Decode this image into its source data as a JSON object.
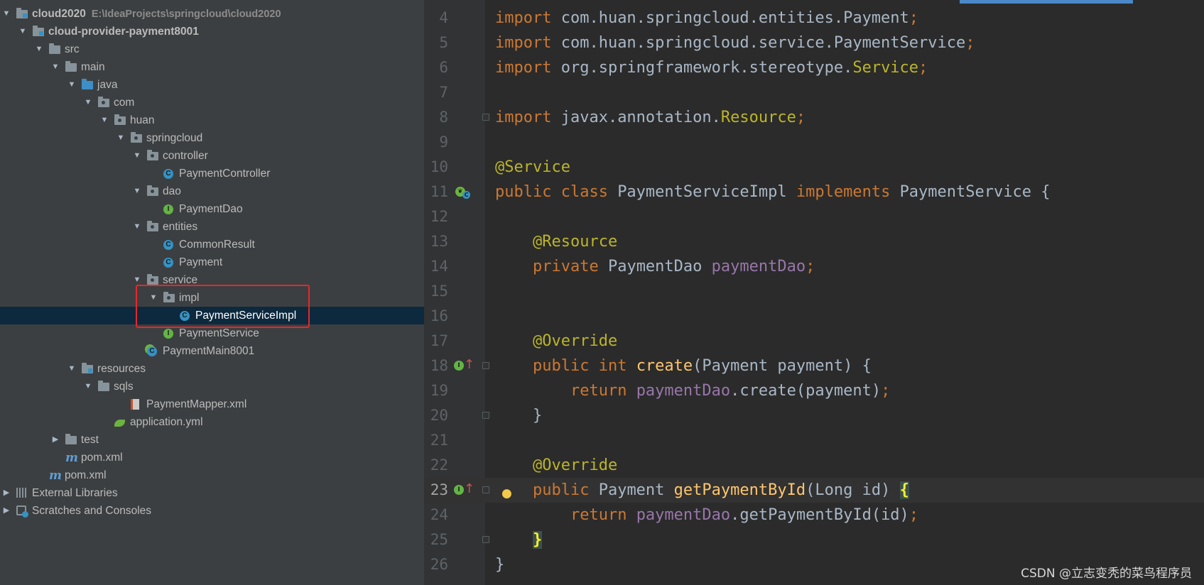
{
  "project_tree": {
    "rows": [
      {
        "label": "cloud2020",
        "path": "E:\\IdeaProjects\\springcloud\\cloud2020",
        "bold": true,
        "arrow": "down",
        "icon": "module-folder-icon",
        "level": 0
      },
      {
        "label": "cloud-provider-payment8001",
        "bold": true,
        "arrow": "down",
        "icon": "module-folder-icon",
        "level": 1
      },
      {
        "label": "src",
        "arrow": "down",
        "icon": "folder-icon",
        "level": 2
      },
      {
        "label": "main",
        "arrow": "down",
        "icon": "folder-icon",
        "level": 3
      },
      {
        "label": "java",
        "arrow": "down",
        "icon": "source-folder-icon",
        "level": 4
      },
      {
        "label": "com",
        "arrow": "down",
        "icon": "package-icon",
        "level": 5
      },
      {
        "label": "huan",
        "arrow": "down",
        "icon": "package-icon",
        "level": 6
      },
      {
        "label": "springcloud",
        "arrow": "down",
        "icon": "package-icon",
        "level": 7
      },
      {
        "label": "controller",
        "arrow": "down",
        "icon": "package-icon",
        "level": 8
      },
      {
        "label": "PaymentController",
        "icon": "class-icon",
        "level": 9
      },
      {
        "label": "dao",
        "arrow": "down",
        "icon": "package-icon",
        "level": 8
      },
      {
        "label": "PaymentDao",
        "icon": "interface-icon",
        "level": 9
      },
      {
        "label": "entities",
        "arrow": "down",
        "icon": "package-icon",
        "level": 8
      },
      {
        "label": "CommonResult",
        "icon": "class-icon",
        "level": 9
      },
      {
        "label": "Payment",
        "icon": "class-icon",
        "level": 9
      },
      {
        "label": "service",
        "arrow": "down",
        "icon": "package-icon",
        "level": 8
      },
      {
        "label": "impl",
        "arrow": "down",
        "icon": "package-icon",
        "level": 9
      },
      {
        "label": "PaymentServiceImpl",
        "icon": "class-icon",
        "level": 10,
        "selected": true
      },
      {
        "label": "PaymentService",
        "icon": "interface-icon",
        "level": 9
      },
      {
        "label": "PaymentMain8001",
        "icon": "spring-boot-class-icon",
        "level": 8
      },
      {
        "label": "resources",
        "arrow": "down",
        "icon": "resources-folder-icon",
        "level": 4
      },
      {
        "label": "sqls",
        "arrow": "down",
        "icon": "folder-icon",
        "level": 5
      },
      {
        "label": "PaymentMapper.xml",
        "icon": "xml-file-icon",
        "level": 7
      },
      {
        "label": "application.yml",
        "icon": "spring-yml-icon",
        "level": 6
      },
      {
        "label": "test",
        "arrow": "right",
        "icon": "folder-icon",
        "level": 3
      },
      {
        "label": "pom.xml",
        "icon": "maven-icon",
        "level": 3
      },
      {
        "label": "pom.xml",
        "icon": "maven-icon",
        "level": 2
      },
      {
        "label": "External Libraries",
        "arrow": "right",
        "icon": "libraries-icon",
        "level": 0
      },
      {
        "label": "Scratches and Consoles",
        "arrow": "right",
        "icon": "scratches-icon",
        "level": 0
      }
    ]
  },
  "editor": {
    "lines": [
      {
        "num": "4",
        "tokens": [
          [
            "kw",
            "import "
          ],
          [
            "",
            "com.huan.springcloud.entities.Payment"
          ],
          [
            "kw",
            ";"
          ]
        ]
      },
      {
        "num": "5",
        "tokens": [
          [
            "kw",
            "import "
          ],
          [
            "",
            "com.huan.springcloud.service.PaymentService"
          ],
          [
            "kw",
            ";"
          ]
        ]
      },
      {
        "num": "6",
        "tokens": [
          [
            "kw",
            "import "
          ],
          [
            "",
            "org.springframework.stereotype."
          ],
          [
            "ann",
            "Service"
          ],
          [
            "kw",
            ";"
          ]
        ]
      },
      {
        "num": "7",
        "tokens": []
      },
      {
        "num": "8",
        "tokens": [
          [
            "kw",
            "import "
          ],
          [
            "",
            "javax.annotation."
          ],
          [
            "ann",
            "Resource"
          ],
          [
            "kw",
            ";"
          ]
        ],
        "fold": true
      },
      {
        "num": "9",
        "tokens": []
      },
      {
        "num": "10",
        "tokens": [
          [
            "ann",
            "@Service"
          ]
        ]
      },
      {
        "num": "11",
        "tokens": [
          [
            "kw",
            "public class "
          ],
          [
            "",
            "PaymentServiceImpl "
          ],
          [
            "kw",
            "implements "
          ],
          [
            "",
            "PaymentService {"
          ]
        ],
        "gutter": "spring-bean"
      },
      {
        "num": "12",
        "tokens": []
      },
      {
        "num": "13",
        "tokens": [
          [
            "",
            "    "
          ],
          [
            "ann",
            "@Resource"
          ]
        ]
      },
      {
        "num": "14",
        "tokens": [
          [
            "",
            "    "
          ],
          [
            "kw",
            "private "
          ],
          [
            "",
            "PaymentDao "
          ],
          [
            "field",
            "paymentDao"
          ],
          [
            "kw",
            ";"
          ]
        ]
      },
      {
        "num": "15",
        "tokens": []
      },
      {
        "num": "16",
        "tokens": []
      },
      {
        "num": "17",
        "tokens": [
          [
            "",
            "    "
          ],
          [
            "ann",
            "@Override"
          ]
        ]
      },
      {
        "num": "18",
        "tokens": [
          [
            "",
            "    "
          ],
          [
            "kw",
            "public int "
          ],
          [
            "fn",
            "create"
          ],
          [
            "",
            "(Payment payment) {"
          ]
        ],
        "gutter": "implements",
        "fold": true
      },
      {
        "num": "19",
        "tokens": [
          [
            "",
            "        "
          ],
          [
            "kw",
            "return "
          ],
          [
            "field",
            "paymentDao"
          ],
          [
            "",
            ".create(payment)"
          ],
          [
            "kw",
            ";"
          ]
        ]
      },
      {
        "num": "20",
        "tokens": [
          [
            "",
            "    }"
          ]
        ],
        "fold": true
      },
      {
        "num": "21",
        "tokens": []
      },
      {
        "num": "22",
        "tokens": [
          [
            "",
            "    "
          ],
          [
            "ann",
            "@Override"
          ]
        ]
      },
      {
        "num": "23",
        "tokens": [
          [
            "",
            "    "
          ],
          [
            "kw",
            "public "
          ],
          [
            "",
            "Payment "
          ],
          [
            "fn",
            "getPaymentById"
          ],
          [
            "",
            "(Long id) "
          ],
          [
            "brace-hl",
            "{"
          ]
        ],
        "gutter": "implements",
        "fold": true,
        "current": true,
        "bulb": true
      },
      {
        "num": "24",
        "tokens": [
          [
            "",
            "        "
          ],
          [
            "kw",
            "return "
          ],
          [
            "field",
            "paymentDao"
          ],
          [
            "",
            ".getPaymentById(id)"
          ],
          [
            "kw",
            ";"
          ]
        ]
      },
      {
        "num": "25",
        "tokens": [
          [
            "",
            "    "
          ],
          [
            "brace-hl",
            "}"
          ]
        ],
        "fold": true
      },
      {
        "num": "26",
        "tokens": [
          [
            "",
            "}"
          ]
        ]
      }
    ]
  },
  "watermark": "CSDN @立志变秃的菜鸟程序员",
  "colors": {
    "highlight_box": "#e8262b",
    "selection": "#0d293e",
    "keyword": "#cc7832",
    "annotation": "#bbb529",
    "field": "#9876aa",
    "function": "#ffc66d"
  }
}
